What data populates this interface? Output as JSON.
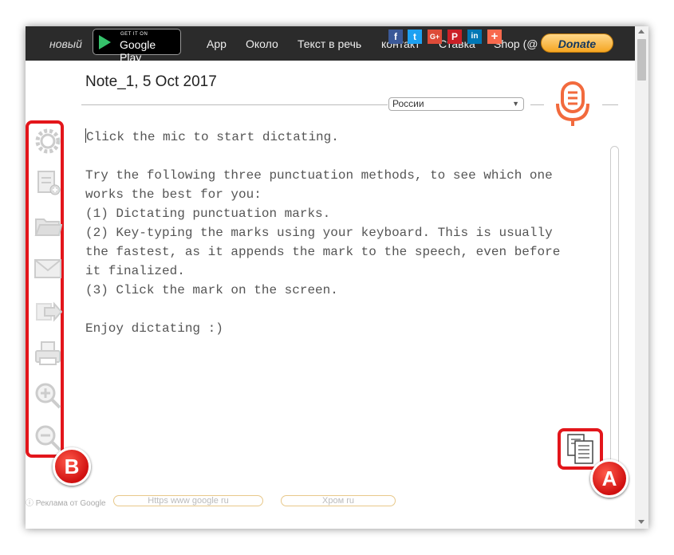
{
  "nav": {
    "novy": "новый",
    "google_play_small": "GET IT ON",
    "google_play": "Google Play",
    "links": [
      "App",
      "Около",
      "Текст в речь",
      "контакт",
      "Ставка",
      "Shop (@"
    ],
    "share": [
      "f",
      "t",
      "G+",
      "P",
      "in",
      "+"
    ],
    "donate": "Donate"
  },
  "note": {
    "title": "Note_1, 5 Oct 2017",
    "language": "России"
  },
  "editor": {
    "text": "Click the mic to start dictating.\n\nTry the following three punctuation methods, to see which one\nworks the best for you:\n(1) Dictating punctuation marks.\n(2) Key-typing the marks using your keyboard. This is usually\nthe fastest, as it appends the mark to the speech, even before\nit finalized.\n(3) Click the mark on the screen.\n\nEnjoy dictating :)"
  },
  "sidebar": {
    "icons": [
      "gear-icon",
      "new-note-icon",
      "folder-icon",
      "mail-icon",
      "forward-icon",
      "print-icon",
      "zoom-in-icon",
      "zoom-out-icon"
    ]
  },
  "badges": {
    "a": "A",
    "b": "B"
  },
  "ads": {
    "label": "ⓘ Реклама от Google",
    "pill1": "Https www google ru",
    "pill2": "Хром ru"
  },
  "colors": {
    "highlight": "#e3161b",
    "accent_mic": "#f26a3d",
    "topbar": "#2b2b2b"
  }
}
